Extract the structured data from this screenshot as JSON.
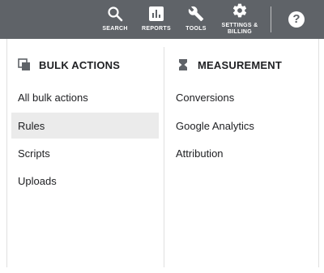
{
  "topbar": {
    "search_label": "SEARCH",
    "reports_label": "REPORTS",
    "tools_label": "TOOLS",
    "settings_label_1": "SETTINGS &",
    "settings_label_2": "BILLING",
    "help_label": "?"
  },
  "left_column": {
    "title": "BULK ACTIONS",
    "items": [
      {
        "label": "All bulk actions"
      },
      {
        "label": "Rules",
        "selected": true
      },
      {
        "label": "Scripts"
      },
      {
        "label": "Uploads"
      }
    ]
  },
  "right_column": {
    "title": "MEASUREMENT",
    "items": [
      {
        "label": "Conversions"
      },
      {
        "label": "Google Analytics"
      },
      {
        "label": "Attribution"
      }
    ]
  },
  "colors": {
    "topbar_bg": "#5f6368",
    "selected_bg": "#ebebeb",
    "text": "#202124"
  }
}
